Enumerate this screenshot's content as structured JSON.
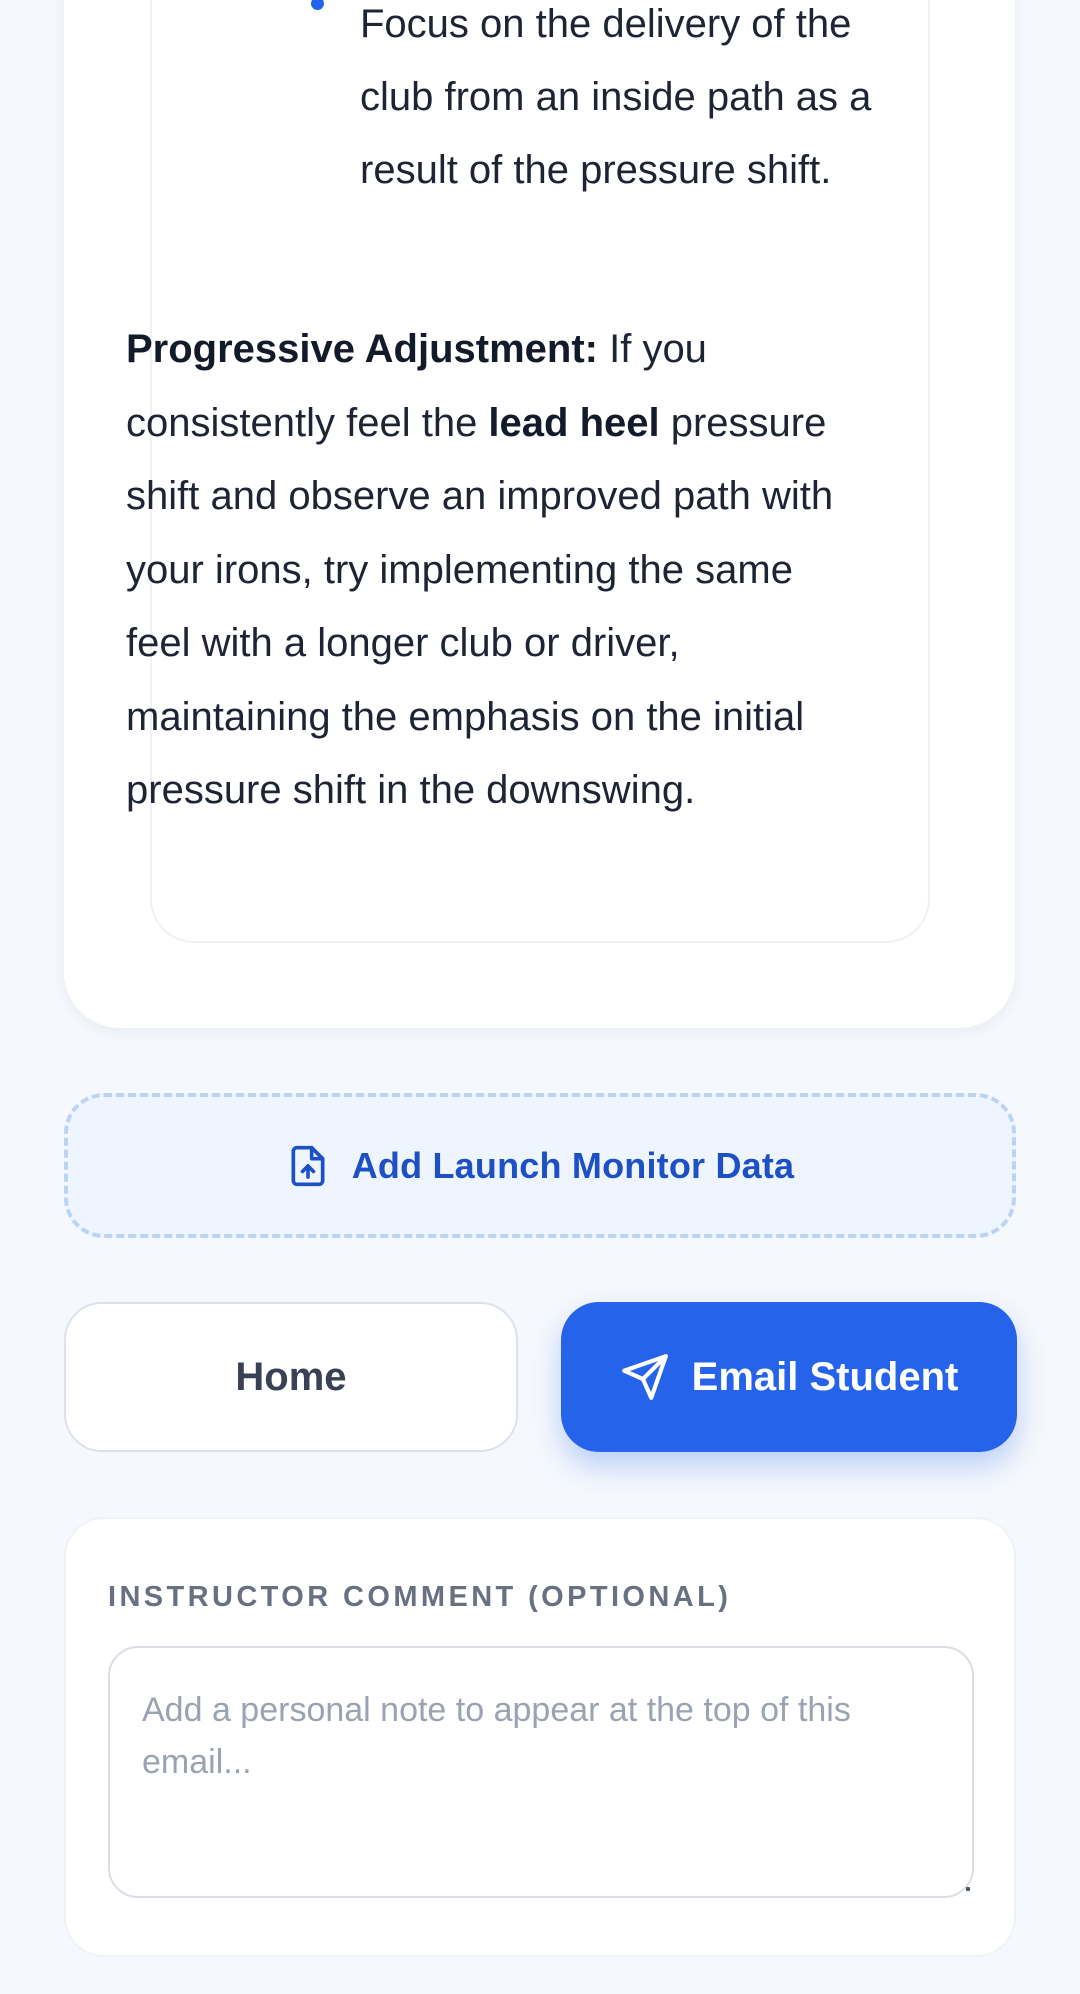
{
  "feedback": {
    "bullet_text": "Focus on the delivery of the club from an inside path as a result of the pressure shift.",
    "progressive": {
      "heading": "Progressive Adjustment:",
      "text_1": " If you consistently feel the ",
      "emphasis": "lead heel",
      "text_2": " pressure shift and observe an improved path with your irons, try implementing the same feel with a longer club or driver, maintaining the emphasis on the initial pressure shift in the downswing."
    }
  },
  "actions": {
    "launch_monitor_label": "Add Launch Monitor Data",
    "home_label": "Home",
    "email_label": "Email Student"
  },
  "comment": {
    "label": "INSTRUCTOR COMMENT (OPTIONAL)",
    "placeholder": "Add a personal note to appear at the top of this email...",
    "value": ""
  },
  "icons": {
    "launch": "file-upload-icon",
    "send": "send-icon"
  },
  "colors": {
    "accent": "#2563eb",
    "accent_text": "#1d4fc7",
    "launch_bg": "#eef5fe",
    "launch_border": "#bcd4f3",
    "page_bg": "#f5f8fc"
  }
}
